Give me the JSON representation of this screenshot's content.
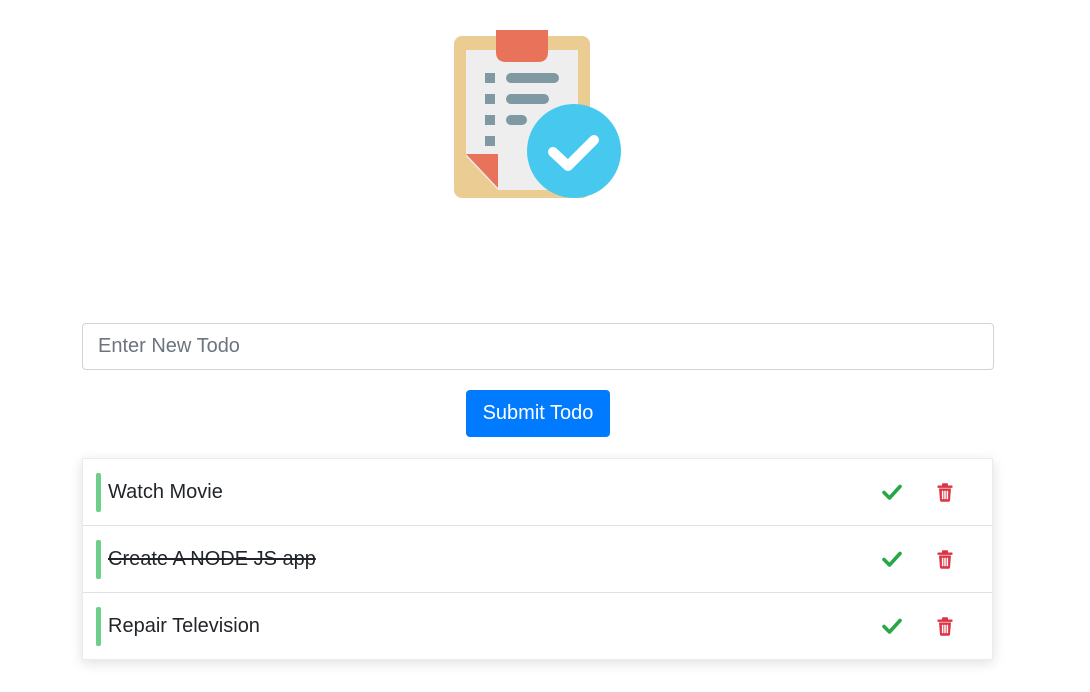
{
  "app": {
    "logo_icon": "clipboard-checklist-icon"
  },
  "form": {
    "input_value": "",
    "input_placeholder": "Enter New Todo",
    "submit_label": "Submit Todo"
  },
  "todos": [
    {
      "text": "Watch Movie",
      "completed": false
    },
    {
      "text": "Create A NODE JS app",
      "completed": true
    },
    {
      "text": "Repair Television",
      "completed": false
    }
  ],
  "icons": {
    "complete": "check-icon",
    "delete": "trash-icon"
  },
  "colors": {
    "primary": "#007bff",
    "accent_bar": "#6fcf8a",
    "check": "#28a745",
    "delete": "#dc3545"
  }
}
